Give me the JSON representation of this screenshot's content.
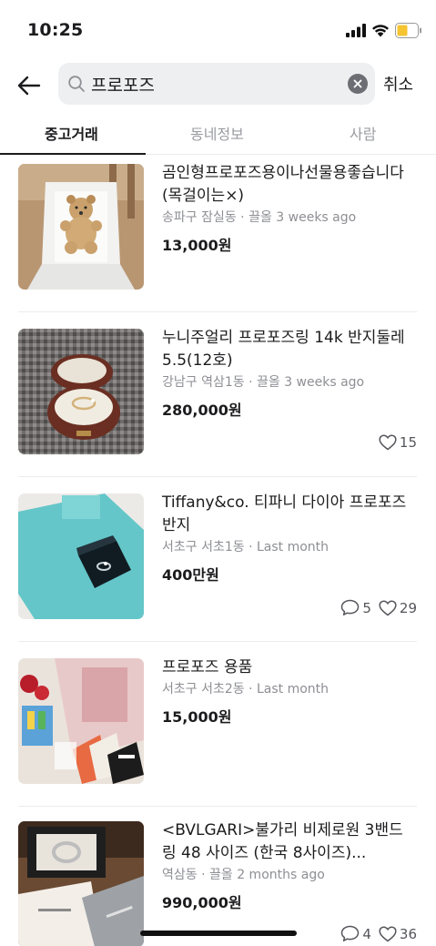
{
  "status_bar": {
    "time": "10:25"
  },
  "search": {
    "query": "프로포즈",
    "cancel_label": "취소"
  },
  "tabs": [
    {
      "label": "중고거래",
      "active": true
    },
    {
      "label": "동네정보",
      "active": false
    },
    {
      "label": "사람",
      "active": false
    }
  ],
  "items": [
    {
      "title": "곰인형프로포즈용이나선물용좋습니다(목걸이는×)",
      "meta": "송파구 잠실동 · 끌올 3 weeks ago",
      "price": "13,000원",
      "chats": null,
      "likes": null,
      "thumb": "teddy-bear"
    },
    {
      "title": "누니주얼리 프로포즈링 14k 반지둘레 5.5(12호)",
      "meta": "강남구 역삼1동 · 끌올 3 weeks ago",
      "price": "280,000원",
      "chats": null,
      "likes": "15",
      "thumb": "ring-box"
    },
    {
      "title": "Tiffany&co. 티파니 다이아 프로포즈 반지",
      "meta": "서초구 서초1동 · Last month",
      "price": "400만원",
      "chats": "5",
      "likes": "29",
      "thumb": "tiffany-box"
    },
    {
      "title": "프로포즈 용품",
      "meta": "서초구 서초2동 · Last month",
      "price": "15,000원",
      "chats": null,
      "likes": null,
      "thumb": "proposal-kit"
    },
    {
      "title": "<BVLGARI>불가리 비제로원 3밴드 링 48 사이즈 (한국 8사이즈)...",
      "meta": "역삼동 · 끌올 2 months ago",
      "price": "990,000원",
      "chats": "4",
      "likes": "36",
      "thumb": "bvlgari-box"
    }
  ],
  "colors": {
    "text": "#1c1c1e",
    "muted": "#8e8f94",
    "tiffany": "#5ec5c7"
  }
}
